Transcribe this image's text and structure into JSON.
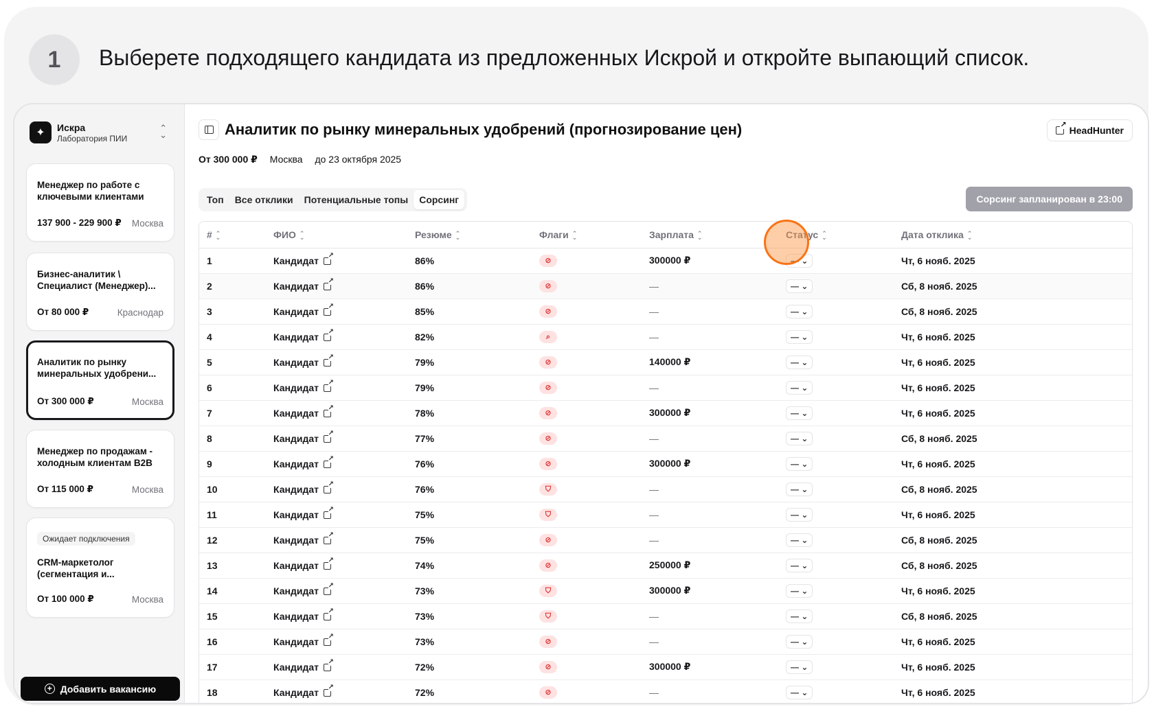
{
  "instruction": {
    "step": "1",
    "text": "Выберете подходящего кандидата из предложенных Искрой и откройте выпающий список."
  },
  "sidebar": {
    "org_name": "Искра",
    "org_sub": "Лаборатория ПИИ",
    "vacancies": [
      {
        "title": "Менеджер по работе с ключевыми клиентами",
        "salary": "137 900 - 229 900 ₽",
        "city": "Москва",
        "badge": ""
      },
      {
        "title": "Бизнес-аналитик \\ Специалист (Менеджер)...",
        "salary": "От 80 000 ₽",
        "city": "Краснодар",
        "badge": ""
      },
      {
        "title": "Аналитик по рынку минеральных удобрени...",
        "salary": "От 300 000 ₽",
        "city": "Москва",
        "badge": ""
      },
      {
        "title": "Менеджер по продажам - холодным клиентам B2B",
        "salary": "От 115 000 ₽",
        "city": "Москва",
        "badge": ""
      },
      {
        "title": "CRM-маркетолог (сегментация и...",
        "salary": "От 100 000 ₽",
        "city": "Москва",
        "badge": "Ожидает подключения"
      }
    ],
    "add_button": "Добавить вакансию"
  },
  "header": {
    "title": "Аналитик по рынку минеральных удобрений (прогнозирование цен)",
    "hh_button": "HeadHunter",
    "salary": "От 300 000 ₽",
    "city": "Москва",
    "deadline": "до 23 октября 2025"
  },
  "tabs": [
    "Топ",
    "Все отклики",
    "Потенциальные топы",
    "Сорсинг"
  ],
  "active_tab": "Сорсинг",
  "sourcing_button": "Сорсинг запланирован в 23:00",
  "table": {
    "columns": [
      "#",
      "ФИО",
      "Резюме",
      "Флаги",
      "Зарплата",
      "Статус",
      "Дата отклика"
    ],
    "status_value": "—",
    "rows": [
      {
        "n": "1",
        "name": "Кандидат",
        "resume": "86%",
        "flag": "block",
        "salary": "300000 ₽",
        "date": "Чт, 6 нояб. 2025"
      },
      {
        "n": "2",
        "name": "Кандидат",
        "resume": "86%",
        "flag": "block",
        "salary": "—",
        "date": "Сб, 8 нояб. 2025"
      },
      {
        "n": "3",
        "name": "Кандидат",
        "resume": "85%",
        "flag": "block",
        "salary": "—",
        "date": "Сб, 8 нояб. 2025"
      },
      {
        "n": "4",
        "name": "Кандидат",
        "resume": "82%",
        "flag": "search",
        "salary": "—",
        "date": "Чт, 6 нояб. 2025"
      },
      {
        "n": "5",
        "name": "Кандидат",
        "resume": "79%",
        "flag": "block",
        "salary": "140000 ₽",
        "date": "Чт, 6 нояб. 2025"
      },
      {
        "n": "6",
        "name": "Кандидат",
        "resume": "79%",
        "flag": "block",
        "salary": "—",
        "date": "Чт, 6 нояб. 2025"
      },
      {
        "n": "7",
        "name": "Кандидат",
        "resume": "78%",
        "flag": "block",
        "salary": "300000 ₽",
        "date": "Чт, 6 нояб. 2025"
      },
      {
        "n": "8",
        "name": "Кандидат",
        "resume": "77%",
        "flag": "block",
        "salary": "—",
        "date": "Сб, 8 нояб. 2025"
      },
      {
        "n": "9",
        "name": "Кандидат",
        "resume": "76%",
        "flag": "block",
        "salary": "300000 ₽",
        "date": "Чт, 6 нояб. 2025"
      },
      {
        "n": "10",
        "name": "Кандидат",
        "resume": "76%",
        "flag": "shield",
        "salary": "—",
        "date": "Сб, 8 нояб. 2025"
      },
      {
        "n": "11",
        "name": "Кандидат",
        "resume": "75%",
        "flag": "shield",
        "salary": "—",
        "date": "Чт, 6 нояб. 2025"
      },
      {
        "n": "12",
        "name": "Кандидат",
        "resume": "75%",
        "flag": "block",
        "salary": "—",
        "date": "Сб, 8 нояб. 2025"
      },
      {
        "n": "13",
        "name": "Кандидат",
        "resume": "74%",
        "flag": "block",
        "salary": "250000 ₽",
        "date": "Сб, 8 нояб. 2025"
      },
      {
        "n": "14",
        "name": "Кандидат",
        "resume": "73%",
        "flag": "shield",
        "salary": "300000 ₽",
        "date": "Чт, 6 нояб. 2025"
      },
      {
        "n": "15",
        "name": "Кандидат",
        "resume": "73%",
        "flag": "shield",
        "salary": "—",
        "date": "Сб, 8 нояб. 2025"
      },
      {
        "n": "16",
        "name": "Кандидат",
        "resume": "73%",
        "flag": "block",
        "salary": "—",
        "date": "Чт, 6 нояб. 2025"
      },
      {
        "n": "17",
        "name": "Кандидат",
        "resume": "72%",
        "flag": "block",
        "salary": "300000 ₽",
        "date": "Чт, 6 нояб. 2025"
      },
      {
        "n": "18",
        "name": "Кандидат",
        "resume": "72%",
        "flag": "block",
        "salary": "—",
        "date": "Чт, 6 нояб. 2025"
      }
    ]
  }
}
